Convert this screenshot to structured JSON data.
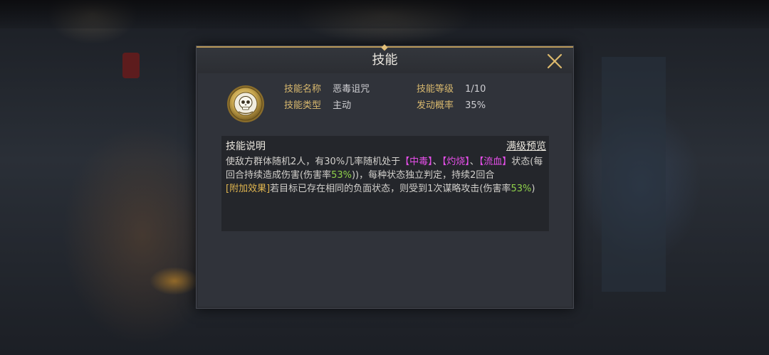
{
  "dialog": {
    "title": "技能",
    "close_icon": "close-icon"
  },
  "skill": {
    "icon": "skull-icon",
    "name_label": "技能名称",
    "name_value": "恶毒诅咒",
    "type_label": "技能类型",
    "type_value": "主动",
    "level_label": "技能等级",
    "level_value": "1/10",
    "rate_label": "发动概率",
    "rate_value": "35%"
  },
  "description": {
    "title": "技能说明",
    "preview_link": "满级预览",
    "segments": {
      "s1": "使敌方群体随机2人，有30%几率随机处于",
      "k1": "【中毒】",
      "sep1": "、",
      "k2": "【灼烧】",
      "sep2": "、",
      "k3": "【流血】",
      "s2": "状态(每回合持续造成伤害(伤害率",
      "p1": "53%",
      "s3": "))，每种状态独立判定，持续2回合",
      "extra_tag": "[附加效果]",
      "s4": "若目标已存在相同的负面状态，则受到1次谋略攻击(伤害率",
      "p2": "53%",
      "s5": ")"
    }
  },
  "colors": {
    "label_gold": "#d8b86e",
    "keyword_magenta": "#e54fe8",
    "percent_green": "#8fd14a",
    "title_border_gold": "#b89758"
  }
}
